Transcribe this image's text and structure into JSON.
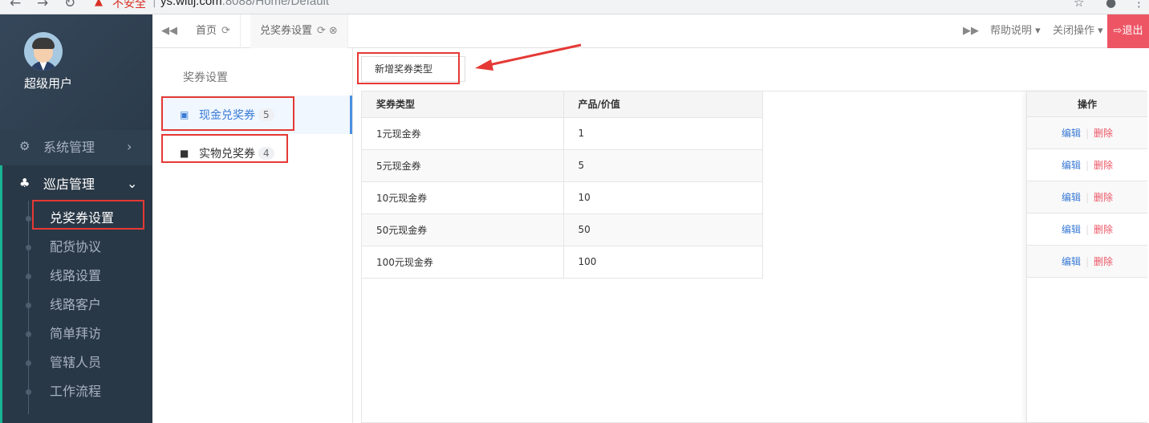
{
  "browser": {
    "security_label": "不安全",
    "url_host": "ys.witlj.com",
    "url_rest": ":8088/Home/Default"
  },
  "sidebar": {
    "user_name": "超级用户",
    "menu": [
      {
        "label": "系统管理",
        "icon": "gears-icon",
        "expanded": false
      },
      {
        "label": "巡店管理",
        "icon": "sitemap-icon",
        "expanded": true
      }
    ],
    "submenu": [
      "兑奖券设置",
      "配货协议",
      "线路设置",
      "线路客户",
      "简单拜访",
      "管辖人员",
      "工作流程"
    ],
    "active_submenu": "兑奖券设置"
  },
  "tabbar": {
    "tabs": [
      {
        "label": "首页"
      },
      {
        "label": "兑奖券设置"
      }
    ],
    "help_label": "帮助说明",
    "close_ops_label": "关闭操作",
    "exit_label": "退出"
  },
  "categories": {
    "title": "奖券设置",
    "items": [
      {
        "label": "现金兑奖券",
        "count": "5",
        "icon": "money-icon"
      },
      {
        "label": "实物兑奖券",
        "count": "4",
        "icon": "gift-icon"
      }
    ]
  },
  "main": {
    "add_button": "新增奖券类型",
    "columns": [
      "奖券类型",
      "产品/价值"
    ],
    "ops_header": "操作",
    "edit_label": "编辑",
    "delete_label": "删除",
    "rows": [
      {
        "type": "1元现金券",
        "value": "1"
      },
      {
        "type": "5元现金券",
        "value": "5"
      },
      {
        "type": "10元现金券",
        "value": "10"
      },
      {
        "type": "50元现金券",
        "value": "50"
      },
      {
        "type": "100元现金券",
        "value": "100"
      }
    ]
  },
  "colors": {
    "sidebar_bg": "#2f4050",
    "accent": "#1ab394",
    "link_blue": "#3a7bd5",
    "danger": "#ed5565",
    "annotation_red": "#e53935"
  }
}
